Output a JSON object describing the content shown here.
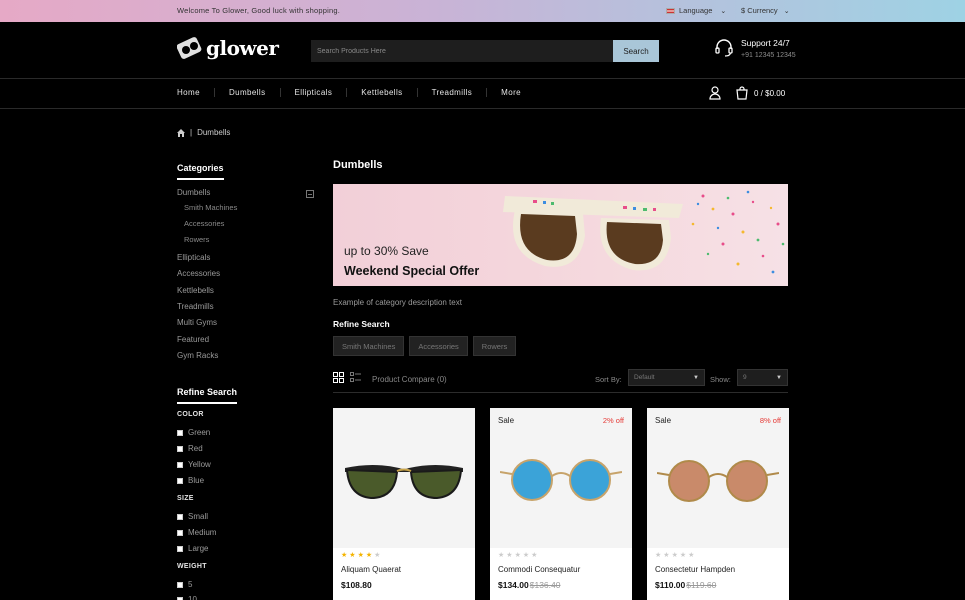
{
  "topbar": {
    "welcome": "Welcome To Glower, Good luck with shopping.",
    "language": "Language",
    "currency": "$ Currency"
  },
  "header": {
    "logo": "glower",
    "search_placeholder": "Search Products Here",
    "search_button": "Search",
    "support_title": "Support 24/7",
    "support_phone": "+91 12345 12345"
  },
  "nav": {
    "items": [
      "Home",
      "Dumbells",
      "Ellipticals",
      "Kettlebells",
      "Treadmills",
      "More"
    ],
    "cart": "0 / $0.00"
  },
  "breadcrumb": {
    "current": "Dumbells"
  },
  "sidebar": {
    "categories_title": "Categories",
    "categories": [
      {
        "label": "Dumbells",
        "children": [
          "Smith Machines",
          "Accessories",
          "Rowers"
        ]
      },
      {
        "label": "Ellipticals"
      },
      {
        "label": "Accessories"
      },
      {
        "label": "Kettlebells"
      },
      {
        "label": "Treadmills"
      },
      {
        "label": "Multi Gyms"
      },
      {
        "label": "Featured"
      },
      {
        "label": "Gym Racks"
      }
    ],
    "refine_title": "Refine Search",
    "filters": [
      {
        "name": "COLOR",
        "options": [
          "Green",
          "Red",
          "Yellow",
          "Blue"
        ]
      },
      {
        "name": "SIZE",
        "options": [
          "Small",
          "Medium",
          "Large"
        ]
      },
      {
        "name": "WEIGHT",
        "options": [
          "5",
          "10"
        ]
      }
    ]
  },
  "main": {
    "title": "Dumbells",
    "banner": {
      "line1": "up to 30% Save",
      "line2": "Weekend Special Offer"
    },
    "description": "Example of category description text",
    "refine_title": "Refine Search",
    "refine_tags": [
      "Smith Machines",
      "Accessories",
      "Rowers"
    ],
    "compare": "Product Compare (0)",
    "sort_label": "Sort By:",
    "sort_value": "Default",
    "show_label": "Show:",
    "show_value": "9"
  },
  "products": [
    {
      "name": "Aliquam Quaerat",
      "price": "$108.80",
      "old_price": "",
      "sale": "",
      "discount": "",
      "rating": 4,
      "lens_color": "#4a5a2a"
    },
    {
      "name": "Commodi Consequatur",
      "price": "$134.00",
      "old_price": "$136.40",
      "sale": "Sale",
      "discount": "2% off",
      "rating": 0,
      "lens_color": "#3ba3d8"
    },
    {
      "name": "Consectetur Hampden",
      "price": "$110.00",
      "old_price": "$119.60",
      "sale": "Sale",
      "discount": "8% off",
      "rating": 0,
      "lens_color": "#c98a6a"
    }
  ]
}
